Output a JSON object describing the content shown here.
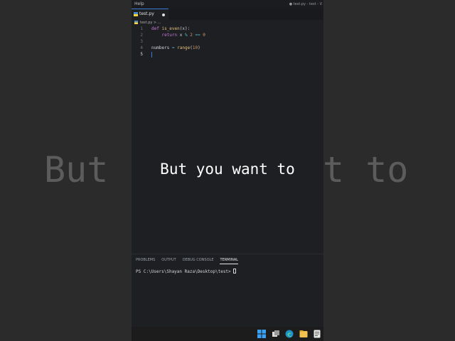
{
  "background_caption": {
    "left": "But",
    "right": "t to"
  },
  "caption": "But you want to",
  "window": {
    "menu_item": "Help",
    "title": "● test.py - test - V"
  },
  "tab": {
    "label": "test.py"
  },
  "breadcrumb": {
    "file": "test.py",
    "rest": "> ..."
  },
  "editor": {
    "line_numbers": [
      "1",
      "2",
      "3",
      "4",
      "5"
    ],
    "lines": {
      "l1_kw": "def",
      "l1_fn": "is_even",
      "l1_rest": "(x):",
      "l2_indent": "    ",
      "l2_kw": "return",
      "l2_rest_a": " x ",
      "l2_op": "%",
      "l2_num1": " 2",
      "l2_eq": " ==",
      "l2_num2": " 0",
      "l4_name": "numbers",
      "l4_eq": " = ",
      "l4_fn": "range",
      "l4_paren_open": "(",
      "l4_num": "10",
      "l4_paren_close": ")"
    }
  },
  "panel": {
    "tabs": [
      "PROBLEMS",
      "OUTPUT",
      "DEBUG CONSOLE",
      "TERMINAL"
    ],
    "active_tab": "TERMINAL",
    "terminal_prompt": "PS C:\\Users\\Shayan Raza\\Desktop\\test>"
  },
  "taskbar_icons": [
    "windows-start-icon",
    "task-view-icon",
    "edge-browser-icon",
    "file-explorer-icon",
    "notepad-icon"
  ]
}
